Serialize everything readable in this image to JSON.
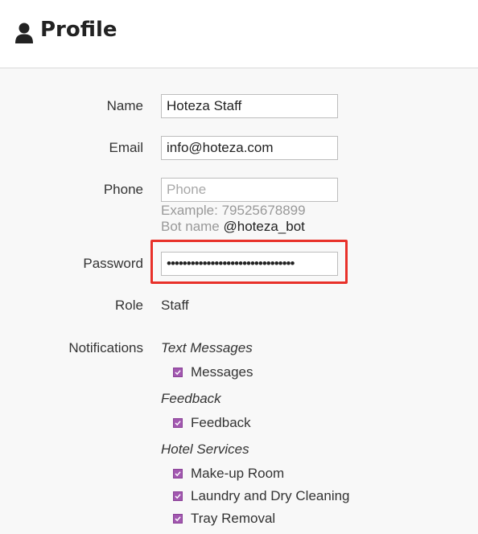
{
  "header": {
    "title": "Profile",
    "icon": "user-icon"
  },
  "form": {
    "name": {
      "label": "Name",
      "value": "Hoteza Staff"
    },
    "email": {
      "label": "Email",
      "value": "info@hoteza.com"
    },
    "phone": {
      "label": "Phone",
      "value": "",
      "placeholder": "Phone",
      "example": "Example: 79525678899",
      "bot_label": "Bot name",
      "bot_name": "@hoteza_bot"
    },
    "password": {
      "label": "Password",
      "value": "••••••••••••••••••••••••••••••••"
    },
    "role": {
      "label": "Role",
      "value": "Staff"
    }
  },
  "notifications": {
    "label": "Notifications",
    "groups": [
      {
        "title": "Text Messages",
        "items": [
          {
            "label": "Messages",
            "checked": true
          }
        ]
      },
      {
        "title": "Feedback",
        "items": [
          {
            "label": "Feedback",
            "checked": true
          }
        ]
      },
      {
        "title": "Hotel Services",
        "items": [
          {
            "label": "Make-up Room",
            "checked": true
          },
          {
            "label": "Laundry and Dry Cleaning",
            "checked": true
          },
          {
            "label": "Tray Removal",
            "checked": true
          }
        ]
      }
    ]
  },
  "colors": {
    "highlight": "#e8312a",
    "checkbox": "#a258b0"
  }
}
